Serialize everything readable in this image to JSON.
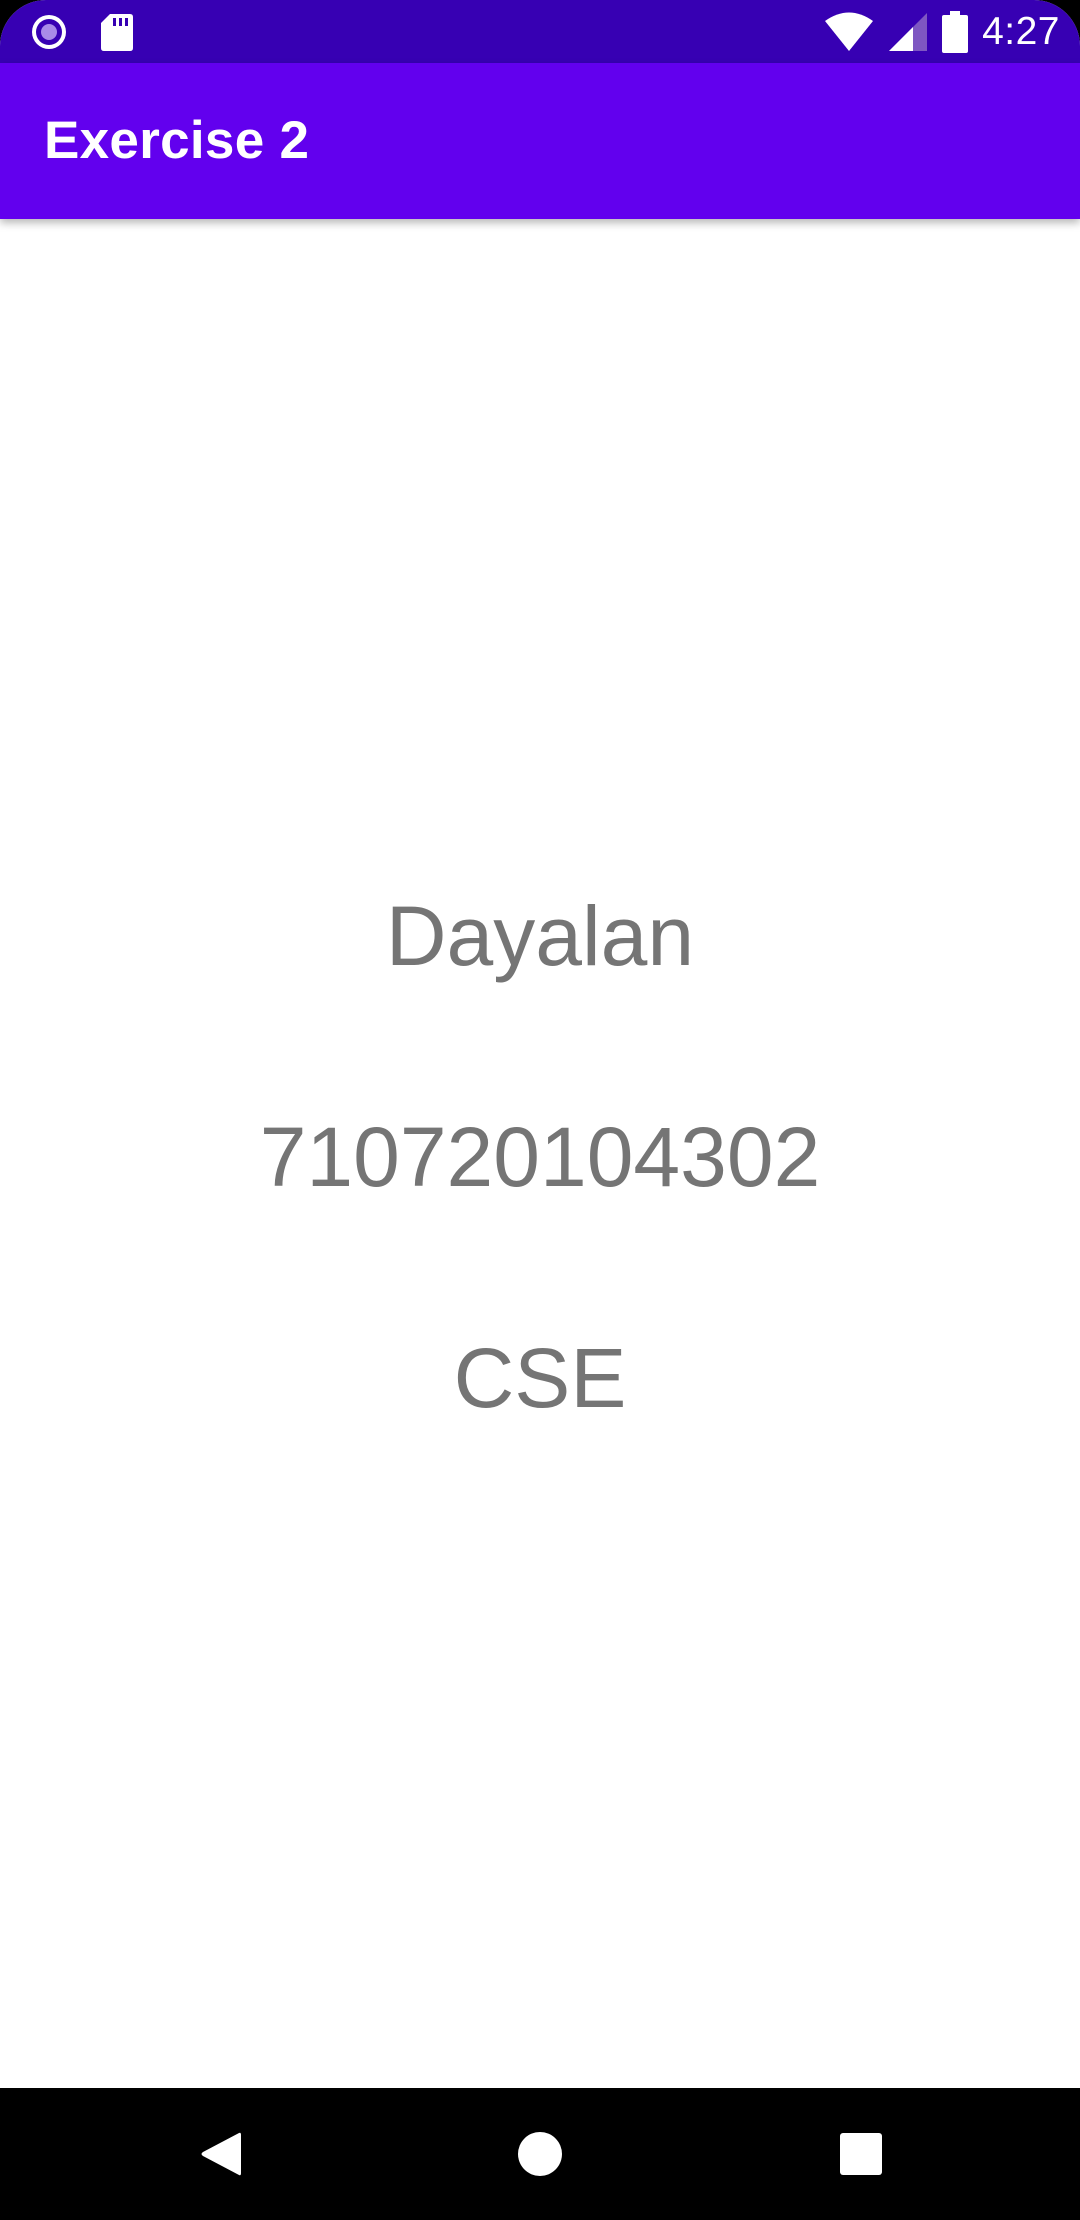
{
  "status_bar": {
    "time": "4:27",
    "icons": [
      "media-record-icon",
      "sd-card-icon",
      "wifi-icon",
      "cell-signal-icon",
      "battery-icon"
    ],
    "background": "#3700b3"
  },
  "app_bar": {
    "title": "Exercise 2",
    "background": "#6200ee"
  },
  "content": {
    "name": "Dayalan",
    "register_number": "710720104302",
    "department": "CSE",
    "text_color": "#757575"
  },
  "nav_bar": {
    "buttons": [
      "back-icon",
      "home-icon",
      "recents-icon"
    ]
  }
}
